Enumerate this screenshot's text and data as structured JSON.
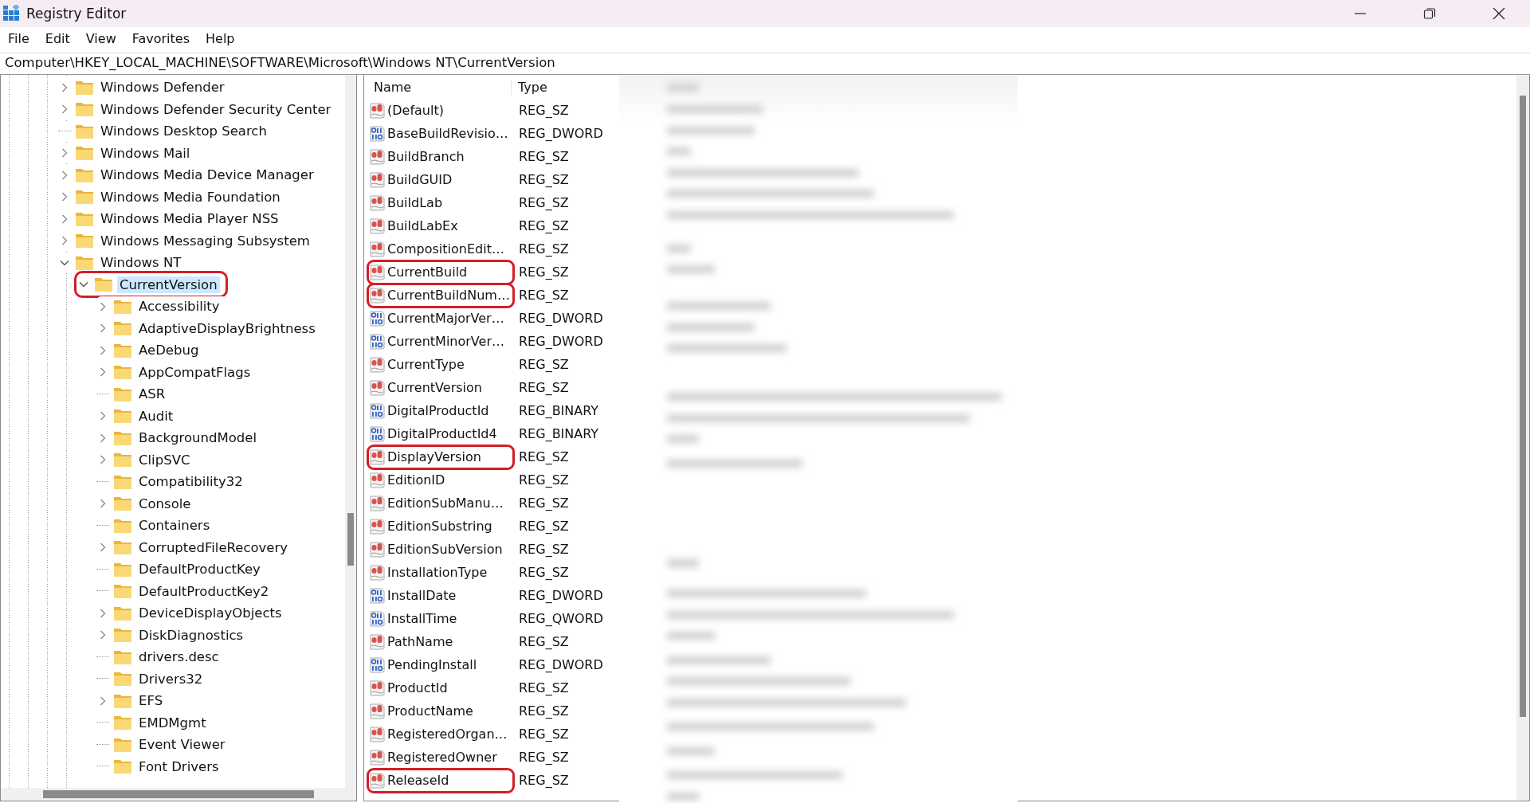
{
  "window": {
    "title": "Registry Editor"
  },
  "menu": [
    "File",
    "Edit",
    "View",
    "Favorites",
    "Help"
  ],
  "address": "Computer\\HKEY_LOCAL_MACHINE\\SOFTWARE\\Microsoft\\Windows NT\\CurrentVersion",
  "tree": [
    {
      "label": "Windows Defender",
      "kind": "collapsed",
      "selected": false,
      "marked": false
    },
    {
      "label": "Windows Defender Security Center",
      "kind": "collapsed",
      "selected": false,
      "marked": false
    },
    {
      "label": "Windows Desktop Search",
      "kind": "leaf",
      "selected": false,
      "marked": false
    },
    {
      "label": "Windows Mail",
      "kind": "collapsed",
      "selected": false,
      "marked": false
    },
    {
      "label": "Windows Media Device Manager",
      "kind": "collapsed",
      "selected": false,
      "marked": false
    },
    {
      "label": "Windows Media Foundation",
      "kind": "collapsed",
      "selected": false,
      "marked": false
    },
    {
      "label": "Windows Media Player NSS",
      "kind": "collapsed",
      "selected": false,
      "marked": false
    },
    {
      "label": "Windows Messaging Subsystem",
      "kind": "collapsed",
      "selected": false,
      "marked": false
    },
    {
      "label": "Windows NT",
      "kind": "expanded",
      "selected": false,
      "marked": false,
      "children": [
        {
          "label": "CurrentVersion",
          "kind": "expanded",
          "selected": true,
          "marked": true,
          "children": [
            {
              "label": "Accessibility",
              "kind": "collapsed",
              "selected": false,
              "marked": false
            },
            {
              "label": "AdaptiveDisplayBrightness",
              "kind": "collapsed",
              "selected": false,
              "marked": false
            },
            {
              "label": "AeDebug",
              "kind": "collapsed",
              "selected": false,
              "marked": false
            },
            {
              "label": "AppCompatFlags",
              "kind": "collapsed",
              "selected": false,
              "marked": false
            },
            {
              "label": "ASR",
              "kind": "leaf",
              "selected": false,
              "marked": false
            },
            {
              "label": "Audit",
              "kind": "collapsed",
              "selected": false,
              "marked": false
            },
            {
              "label": "BackgroundModel",
              "kind": "collapsed",
              "selected": false,
              "marked": false
            },
            {
              "label": "ClipSVC",
              "kind": "collapsed",
              "selected": false,
              "marked": false
            },
            {
              "label": "Compatibility32",
              "kind": "leaf",
              "selected": false,
              "marked": false
            },
            {
              "label": "Console",
              "kind": "collapsed",
              "selected": false,
              "marked": false
            },
            {
              "label": "Containers",
              "kind": "leaf",
              "selected": false,
              "marked": false
            },
            {
              "label": "CorruptedFileRecovery",
              "kind": "collapsed",
              "selected": false,
              "marked": false
            },
            {
              "label": "DefaultProductKey",
              "kind": "leaf",
              "selected": false,
              "marked": false
            },
            {
              "label": "DefaultProductKey2",
              "kind": "leaf",
              "selected": false,
              "marked": false
            },
            {
              "label": "DeviceDisplayObjects",
              "kind": "collapsed",
              "selected": false,
              "marked": false
            },
            {
              "label": "DiskDiagnostics",
              "kind": "collapsed",
              "selected": false,
              "marked": false
            },
            {
              "label": "drivers.desc",
              "kind": "leaf",
              "selected": false,
              "marked": false
            },
            {
              "label": "Drivers32",
              "kind": "leaf",
              "selected": false,
              "marked": false
            },
            {
              "label": "EFS",
              "kind": "collapsed",
              "selected": false,
              "marked": false
            },
            {
              "label": "EMDMgmt",
              "kind": "leaf",
              "selected": false,
              "marked": false
            },
            {
              "label": "Event Viewer",
              "kind": "leaf",
              "selected": false,
              "marked": false
            },
            {
              "label": "Font Drivers",
              "kind": "leaf",
              "selected": false,
              "marked": false
            }
          ]
        }
      ]
    }
  ],
  "values": {
    "columns": [
      "Name",
      "Type"
    ],
    "rows": [
      {
        "name": "(Default)",
        "kind": "string",
        "type": "REG_SZ",
        "marked": false
      },
      {
        "name": "BaseBuildRevisio…",
        "kind": "binary",
        "type": "REG_DWORD",
        "marked": false
      },
      {
        "name": "BuildBranch",
        "kind": "string",
        "type": "REG_SZ",
        "marked": false
      },
      {
        "name": "BuildGUID",
        "kind": "string",
        "type": "REG_SZ",
        "marked": false
      },
      {
        "name": "BuildLab",
        "kind": "string",
        "type": "REG_SZ",
        "marked": false
      },
      {
        "name": "BuildLabEx",
        "kind": "string",
        "type": "REG_SZ",
        "marked": false
      },
      {
        "name": "CompositionEdit…",
        "kind": "string",
        "type": "REG_SZ",
        "marked": false
      },
      {
        "name": "CurrentBuild",
        "kind": "string",
        "type": "REG_SZ",
        "marked": true
      },
      {
        "name": "CurrentBuildNum…",
        "kind": "string",
        "type": "REG_SZ",
        "marked": true
      },
      {
        "name": "CurrentMajorVer…",
        "kind": "binary",
        "type": "REG_DWORD",
        "marked": false
      },
      {
        "name": "CurrentMinorVer…",
        "kind": "binary",
        "type": "REG_DWORD",
        "marked": false
      },
      {
        "name": "CurrentType",
        "kind": "string",
        "type": "REG_SZ",
        "marked": false
      },
      {
        "name": "CurrentVersion",
        "kind": "string",
        "type": "REG_SZ",
        "marked": false
      },
      {
        "name": "DigitalProductId",
        "kind": "binary",
        "type": "REG_BINARY",
        "marked": false
      },
      {
        "name": "DigitalProductId4",
        "kind": "binary",
        "type": "REG_BINARY",
        "marked": false
      },
      {
        "name": "DisplayVersion",
        "kind": "string",
        "type": "REG_SZ",
        "marked": true
      },
      {
        "name": "EditionID",
        "kind": "string",
        "type": "REG_SZ",
        "marked": false
      },
      {
        "name": "EditionSubManu…",
        "kind": "string",
        "type": "REG_SZ",
        "marked": false
      },
      {
        "name": "EditionSubstring",
        "kind": "string",
        "type": "REG_SZ",
        "marked": false
      },
      {
        "name": "EditionSubVersion",
        "kind": "string",
        "type": "REG_SZ",
        "marked": false
      },
      {
        "name": "InstallationType",
        "kind": "string",
        "type": "REG_SZ",
        "marked": false
      },
      {
        "name": "InstallDate",
        "kind": "binary",
        "type": "REG_DWORD",
        "marked": false
      },
      {
        "name": "InstallTime",
        "kind": "binary",
        "type": "REG_QWORD",
        "marked": false
      },
      {
        "name": "PathName",
        "kind": "string",
        "type": "REG_SZ",
        "marked": false
      },
      {
        "name": "PendingInstall",
        "kind": "binary",
        "type": "REG_DWORD",
        "marked": false
      },
      {
        "name": "ProductId",
        "kind": "string",
        "type": "REG_SZ",
        "marked": false
      },
      {
        "name": "ProductName",
        "kind": "string",
        "type": "REG_SZ",
        "marked": false
      },
      {
        "name": "RegisteredOrgan…",
        "kind": "string",
        "type": "REG_SZ",
        "marked": false
      },
      {
        "name": "RegisteredOwner",
        "kind": "string",
        "type": "REG_SZ",
        "marked": false
      },
      {
        "name": "ReleaseId",
        "kind": "string",
        "type": "REG_SZ",
        "marked": true
      }
    ]
  }
}
